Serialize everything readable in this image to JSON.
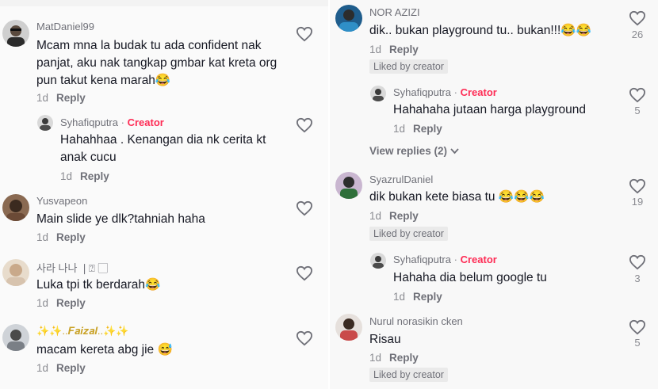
{
  "creator_badge": "Creator",
  "reply_label": "Reply",
  "liked_by_creator": "Liked by creator",
  "left": {
    "c1": {
      "name": "MatDaniel99",
      "text": "Mcam mna la budak tu ada confident nak panjat, aku nak tangkap gmbar kat kreta org pun takut kena marah😂",
      "time": "1d"
    },
    "c1r": {
      "name": "Syhafiqputra",
      "text": "Hahahhaa . Kenangan dia nk cerita kt anak cucu",
      "time": "1d"
    },
    "c2": {
      "name": "Yusvapeon",
      "text": "Main slide ye dlk?tahniah haha",
      "time": "1d"
    },
    "c3": {
      "name": "사라 나나 ❘⍰ ▢",
      "text": "Luka tpi tk berdarah😂",
      "time": "1d"
    },
    "c4": {
      "name": "✨✨..𝑭𝒂𝒊𝒛𝒂𝒍..✨✨",
      "text": "macam kereta abg jie 😅",
      "time": "1d"
    }
  },
  "right": {
    "c1": {
      "name": "NOR AZIZI",
      "text": "dik.. bukan playground tu.. bukan!!!😂😂",
      "time": "1d",
      "likes": "26"
    },
    "c1r": {
      "name": "Syhafiqputra",
      "text": "Hahahaha jutaan harga playground",
      "time": "1d",
      "likes": "5"
    },
    "view_replies": "View replies (2)",
    "c2": {
      "name": "SyazrulDaniel",
      "text": "dik bukan kete biasa tu 😂😂😂",
      "time": "1d",
      "likes": "19"
    },
    "c2r": {
      "name": "Syhafiqputra",
      "text": "Hahaha dia belum google tu",
      "time": "1d",
      "likes": "3"
    },
    "c3": {
      "name": "Nurul norasikin cken",
      "text": "Risau",
      "time": "1d",
      "likes": "5"
    }
  },
  "icons": {
    "like": "heart-outline-icon",
    "expand": "chevron-down-icon"
  },
  "colors": {
    "creator": "#fe2c55",
    "text": "#161823",
    "muted": "#8a8b91"
  }
}
